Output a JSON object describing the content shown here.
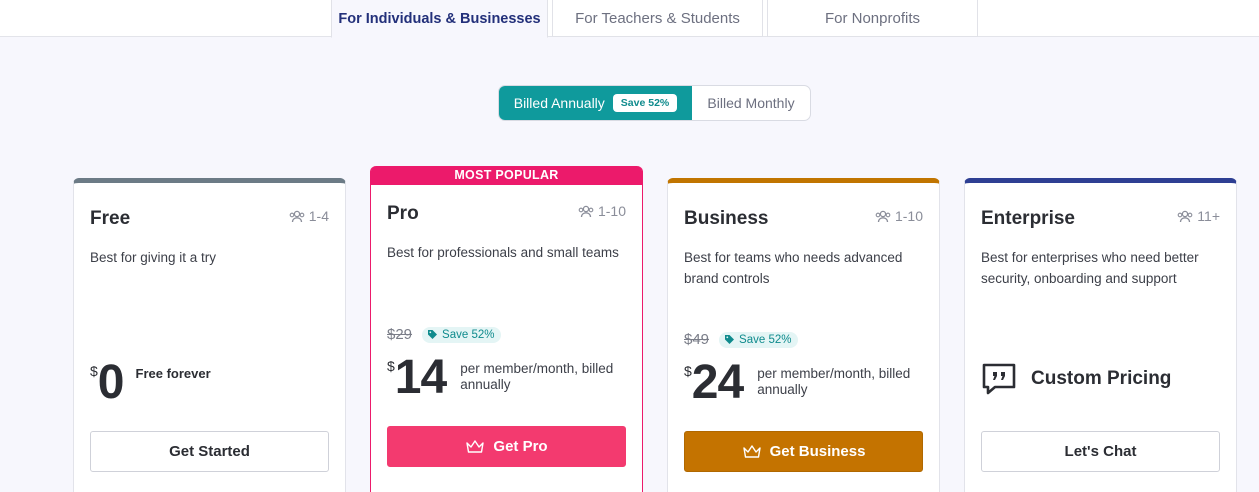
{
  "tabs": [
    {
      "label": "For Individuals & Businesses",
      "active": true
    },
    {
      "label": "For Teachers & Students",
      "active": false
    },
    {
      "label": "For Nonprofits",
      "active": false
    }
  ],
  "billing": {
    "annual_label": "Billed Annually",
    "annual_badge": "Save 52%",
    "monthly_label": "Billed Monthly",
    "selected": "annual"
  },
  "plans": {
    "free": {
      "name": "Free",
      "members": "1-4",
      "description": "Best for giving it a try",
      "currency": "$",
      "price": "0",
      "note": "Free forever",
      "button": "Get Started",
      "accent": "#6c7b86"
    },
    "pro": {
      "badge": "MOST POPULAR",
      "name": "Pro",
      "members": "1-10",
      "description": "Best for professionals and small teams",
      "old_price": "$29",
      "save": "Save 52%",
      "currency": "$",
      "price": "14",
      "period": "per member/month, billed annually",
      "button": "Get Pro",
      "accent": "#ec1a6b"
    },
    "business": {
      "name": "Business",
      "members": "1-10",
      "description": "Best for teams who needs advanced brand controls",
      "old_price": "$49",
      "save": "Save 52%",
      "currency": "$",
      "price": "24",
      "period": "per member/month, billed annually",
      "button": "Get Business",
      "accent": "#c17500"
    },
    "enterprise": {
      "name": "Enterprise",
      "members": "11+",
      "description": "Best for enterprises who need better security, onboarding and support",
      "custom_label": "Custom Pricing",
      "button": "Let's Chat",
      "accent": "#2e3f93"
    }
  },
  "icons": {
    "members": "users-icon",
    "save": "tag-icon",
    "crown": "crown-icon",
    "chat": "quote-chat-icon"
  }
}
